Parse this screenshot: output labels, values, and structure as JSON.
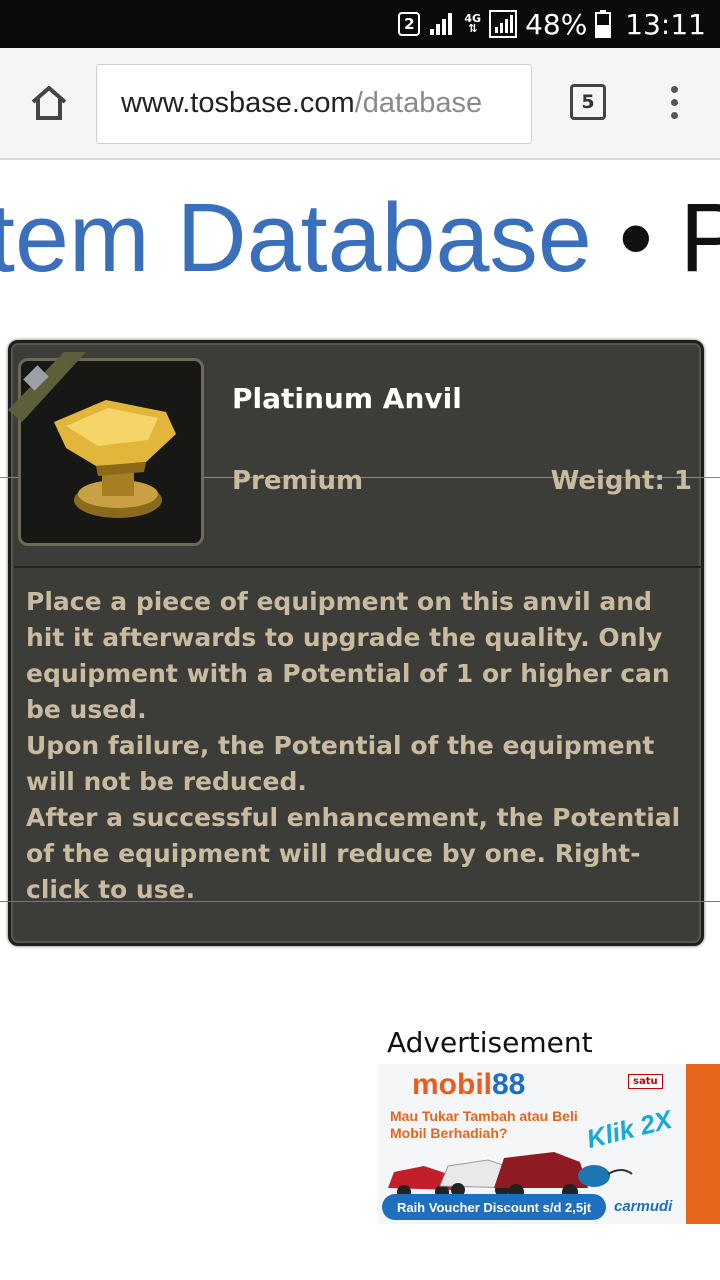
{
  "status_bar": {
    "sim_slot": "2",
    "network_type": "4G",
    "battery_percent": "48%",
    "time": "13:11"
  },
  "browser": {
    "url_host": "www.tosbase.com",
    "url_path": "/database",
    "tab_count": "5",
    "icons": [
      "home-icon",
      "tabs-icon",
      "overflow-menu-icon"
    ]
  },
  "heading": {
    "crumb": "tem Database",
    "separator": " • ",
    "next": "P"
  },
  "item": {
    "name": "Platinum Anvil",
    "grade": "Premium",
    "weight": "Weight: 1",
    "description": [
      "Place a piece of equipment on this anvil and hit it afterwards to upgrade the quality. Only equipment with a Potential of 1 or higher can be used.",
      "Upon failure, the Potential of the equipment will not be reduced.",
      "After a successful enhancement, the Potential of the equipment will reduce by one. Right-click to use."
    ],
    "colors": {
      "card_bg": "#3c3c38",
      "text": "#c9bba0",
      "name": "#ffffff"
    }
  },
  "ad": {
    "label": "Advertisement",
    "brand_word": "mobil",
    "brand_number": "88",
    "partner": "satu",
    "headline": "Mau Tukar Tambah atau Beli Mobil Berhadiah?",
    "cta": "Klik 2X",
    "voucher": "Raih Voucher Discount s/d 2,5jt",
    "sponsor": "carmudi"
  }
}
